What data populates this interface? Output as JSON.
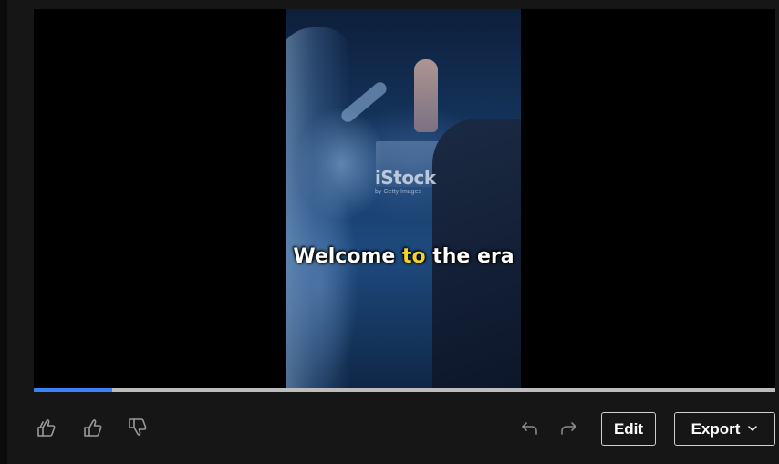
{
  "video": {
    "caption": {
      "before": "Welcome ",
      "highlight": "to",
      "after": " the era"
    },
    "watermark": {
      "brand": "iStock",
      "sub": "by Getty Images"
    },
    "progress_fraction": 0.106,
    "colors": {
      "progress": "#3b82f6",
      "caption_highlight": "#f2d22e"
    }
  },
  "feedback": {
    "icons": [
      "thumbs-up-double-icon",
      "thumbs-up-icon",
      "thumbs-down-icon"
    ]
  },
  "toolbar": {
    "undo_icon": "undo-icon",
    "redo_icon": "redo-icon",
    "edit_label": "Edit",
    "export_label": "Export",
    "export_icon": "chevron-down-icon"
  }
}
